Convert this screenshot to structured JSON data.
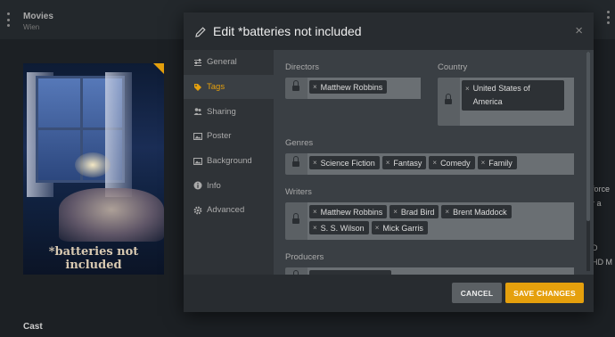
{
  "background": {
    "header_title": "Movies",
    "header_subtitle": "Wien",
    "cast_label": "Cast",
    "side_text_1": "force",
    "side_text_2": "r a",
    "side_text_3": "D",
    "side_text_4": "HD M"
  },
  "poster": {
    "title": "*batteries not included"
  },
  "modal": {
    "title": "Edit *batteries not included",
    "close_symbol": "×",
    "nav": [
      {
        "label": "General",
        "icon": "sliders-icon"
      },
      {
        "label": "Tags",
        "icon": "tag-icon"
      },
      {
        "label": "Sharing",
        "icon": "users-icon"
      },
      {
        "label": "Poster",
        "icon": "image-icon"
      },
      {
        "label": "Background",
        "icon": "image-icon"
      },
      {
        "label": "Info",
        "icon": "info-icon"
      },
      {
        "label": "Advanced",
        "icon": "gear-icon"
      }
    ],
    "active_tab": "Tags",
    "fields": {
      "directors": {
        "label": "Directors",
        "tags": [
          "Matthew Robbins"
        ]
      },
      "country": {
        "label": "Country",
        "tags": [
          "United States of America"
        ]
      },
      "genres": {
        "label": "Genres",
        "tags": [
          "Science Fiction",
          "Fantasy",
          "Comedy",
          "Family"
        ]
      },
      "writers": {
        "label": "Writers",
        "tags": [
          "Matthew Robbins",
          "Brad Bird",
          "Brent Maddock",
          "S. S. Wilson",
          "Mick Garris"
        ]
      },
      "producers": {
        "label": "Producers"
      }
    },
    "tag_remove_symbol": "×",
    "cancel_label": "CANCEL",
    "save_label": "SAVE CHANGES"
  },
  "colors": {
    "accent": "#e5a00d"
  }
}
